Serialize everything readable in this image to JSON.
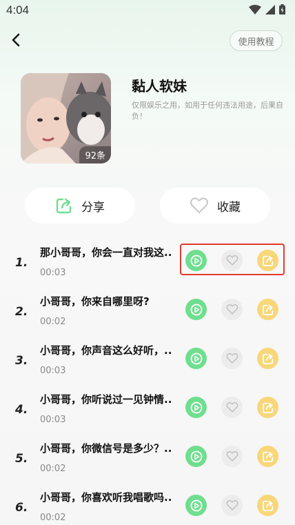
{
  "status_bar": {
    "time": "4:04"
  },
  "header": {
    "tutorial_label": "使用教程"
  },
  "album": {
    "title": "黏人软妹",
    "disclaimer": "仅限娱乐之用，如用于任何违法用途，后果自负！",
    "count": "92条"
  },
  "actions": {
    "share_label": "分享",
    "favorite_label": "收藏"
  },
  "tracks": [
    {
      "index": "1.",
      "title": "那小哥哥，你会一直对我这..",
      "duration": "00:03"
    },
    {
      "index": "2.",
      "title": "小哥哥，你来自哪里呀?",
      "duration": "00:02"
    },
    {
      "index": "3.",
      "title": "小哥哥，你声音这么好听，..",
      "duration": "00:03"
    },
    {
      "index": "4.",
      "title": "小哥哥，你听说过一见钟情..",
      "duration": "00:03"
    },
    {
      "index": "5.",
      "title": "小哥哥，你微信号是多少？..",
      "duration": "00:02"
    },
    {
      "index": "6.",
      "title": "小哥哥，你喜欢听我唱歌吗..",
      "duration": "00:02"
    }
  ],
  "colors": {
    "play": "#6fde8f",
    "like": "#ececec",
    "share": "#f8d77a",
    "highlight": "#e23a2e"
  }
}
